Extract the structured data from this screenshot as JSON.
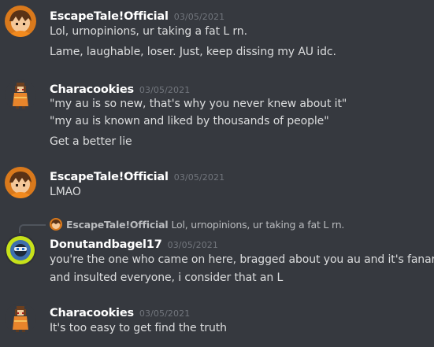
{
  "messages": [
    {
      "author": "EscapeTale!Official",
      "timestamp": "03/05/2021",
      "avatar_icon": "orange-character-avatar",
      "lines": [
        "Lol, urnopinions, ur taking a fat L rn.",
        "Lame, laughable, loser. Just, keep dissing my AU idc."
      ]
    },
    {
      "author": "Characookies",
      "timestamp": "03/05/2021",
      "avatar_icon": "chara-sprite-avatar",
      "lines": [
        "\"my au is so new, that's why you never knew about it\"",
        "\"my au is known and liked by thousands of people\"",
        "Get a better lie"
      ]
    },
    {
      "author": "EscapeTale!Official",
      "timestamp": "03/05/2021",
      "avatar_icon": "orange-character-avatar",
      "lines": [
        "LMAO"
      ]
    },
    {
      "reply": {
        "author": "EscapeTale!Official",
        "text": "Lol, urnopinions, ur taking a fat L rn."
      },
      "author": "Donutandbagel17",
      "timestamp": "03/05/2021",
      "avatar_icon": "donut-character-avatar",
      "lines": [
        "you're the one who came on here, bragged about you au and it's fanart,",
        "and insulted everyone, i consider that an L"
      ]
    },
    {
      "author": "Characookies",
      "timestamp": "03/05/2021",
      "avatar_icon": "chara-sprite-avatar",
      "lines": [
        "It's too easy to get find the truth"
      ]
    }
  ]
}
